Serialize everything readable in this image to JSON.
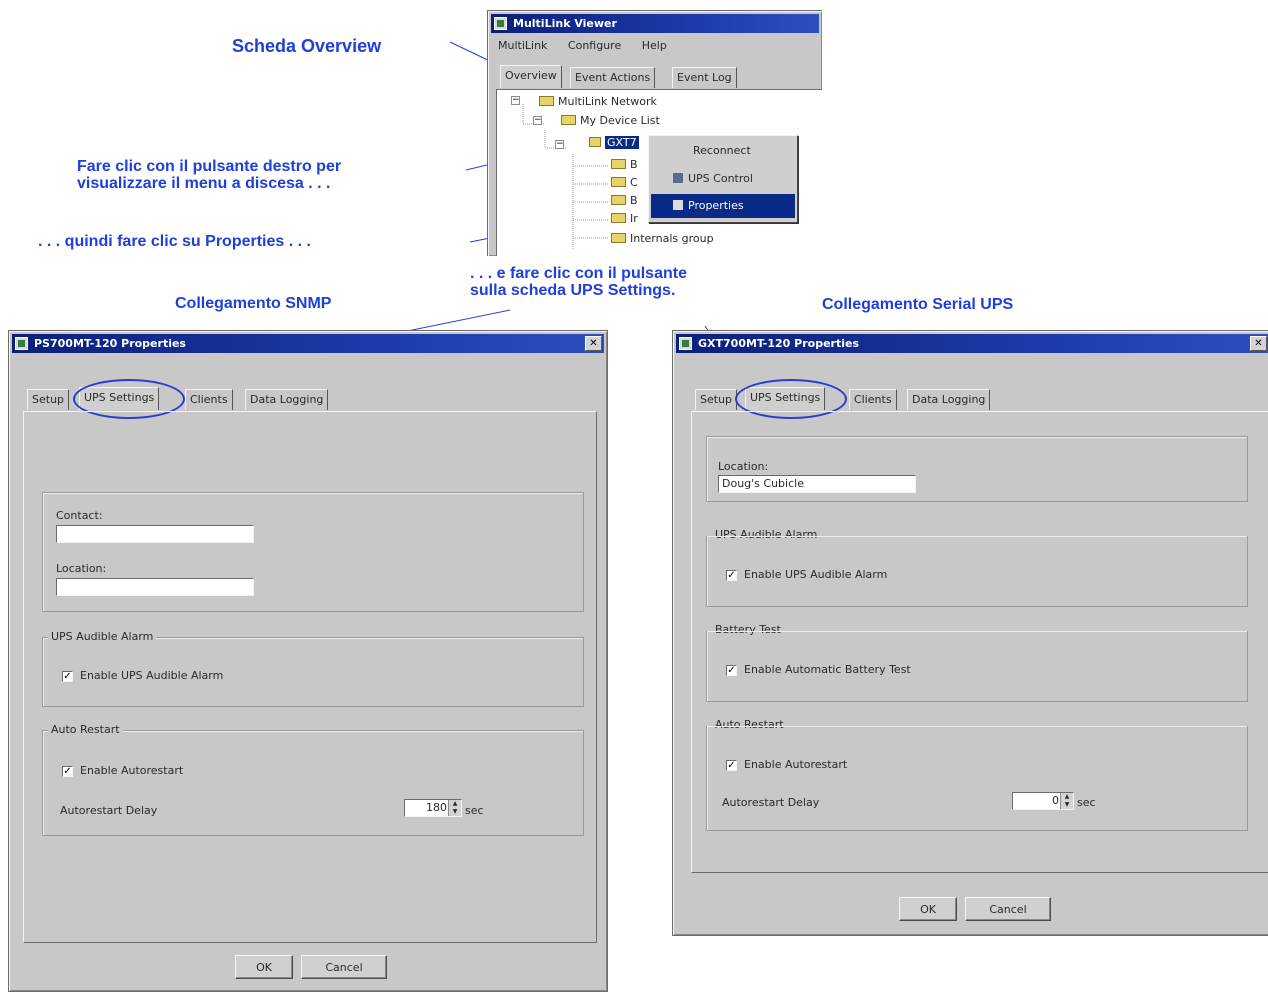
{
  "callouts": {
    "overview_tab": "Scheda Overview",
    "right_click_line1": "Fare clic con il pulsante destro per",
    "right_click_line2": "visualizzare il menu a discesa . . .",
    "click_properties": ". . . quindi fare clic su Properties . . .",
    "ups_settings_line1": ". . . e fare clic con il pulsante",
    "ups_settings_line2": "sulla scheda UPS Settings.",
    "snmp_link": "Collegamento SNMP",
    "serial_link": "Collegamento Serial UPS"
  },
  "viewer": {
    "title": "MultiLink Viewer",
    "menu": [
      "MultiLink",
      "Configure",
      "Help"
    ],
    "tabs": [
      "Overview",
      "Event Actions",
      "Event Log"
    ],
    "tree": {
      "root": "MultiLink Network",
      "device_list": "My Device List",
      "selected_device": "GXT7",
      "children_partial": [
        "B",
        "C",
        "B",
        "Ir"
      ],
      "last_group": "Internals group"
    },
    "context_menu": [
      "Reconnect",
      "UPS Control",
      "Properties"
    ]
  },
  "snmp_dialog": {
    "title": "PS700MT-120 Properties",
    "close": "✕",
    "tabs": [
      "Setup",
      "UPS Settings",
      "Clients",
      "Data Logging"
    ],
    "contact_label": "Contact:",
    "contact_value": "",
    "location_label": "Location:",
    "location_value": "",
    "alarm_group": "UPS Audible Alarm",
    "alarm_checkbox": "Enable UPS Audible Alarm",
    "restart_group": "Auto Restart",
    "restart_checkbox": "Enable Autorestart",
    "delay_label": "Autorestart Delay",
    "delay_value": "180",
    "delay_unit": "sec",
    "ok": "OK",
    "cancel": "Cancel"
  },
  "serial_dialog": {
    "title": "GXT700MT-120 Properties",
    "close": "✕",
    "tabs": [
      "Setup",
      "UPS Settings",
      "Clients",
      "Data Logging"
    ],
    "location_label": "Location:",
    "location_value": "Doug's Cubicle",
    "alarm_group": "UPS Audible Alarm",
    "alarm_checkbox": "Enable UPS Audible Alarm",
    "battery_group": "Battery Test",
    "battery_checkbox": "Enable Automatic Battery Test",
    "restart_group": "Auto Restart",
    "restart_checkbox": "Enable Autorestart",
    "delay_label": "Autorestart Delay",
    "delay_value": "0",
    "delay_unit": "sec",
    "ok": "OK",
    "cancel": "Cancel"
  },
  "colors": {
    "callout_text": "#1f3fd8",
    "titlebar": "#0a1f7a",
    "window_bg": "#c8c8c8",
    "highlight_oval": "#2a3ad0"
  }
}
